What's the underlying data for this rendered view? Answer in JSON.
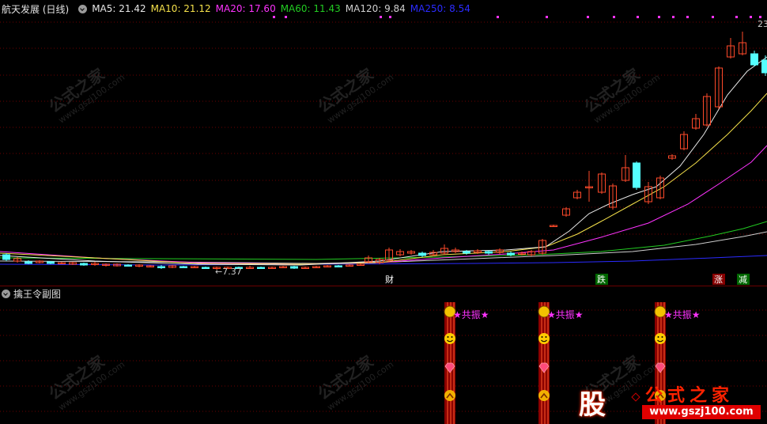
{
  "header": {
    "title": "航天发展 (日线)",
    "indicators": [
      {
        "label": "MA5: 21.42",
        "color": "#e8e8e8"
      },
      {
        "label": "MA10: 21.12",
        "color": "#f5e14a"
      },
      {
        "label": "MA20: 17.60",
        "color": "#ff33ff"
      },
      {
        "label": "MA60: 11.43",
        "color": "#22cc22"
      },
      {
        "label": "MA120: 9.84",
        "color": "#cfcfcf"
      },
      {
        "label": "MA250: 8.54",
        "color": "#2b2bff"
      }
    ]
  },
  "main_chart": {
    "price_high_label": "23",
    "price_low_label": "←7.37",
    "event_labels": [
      {
        "text": "财",
        "color": "#ffffff",
        "bg": "#000000"
      },
      {
        "text": "跌",
        "color": "#ffffff",
        "bg": "#006600"
      },
      {
        "text": "涨",
        "color": "#ffffff",
        "bg": "#880000"
      },
      {
        "text": "减",
        "color": "#ffffff",
        "bg": "#006600"
      }
    ]
  },
  "sub_chart": {
    "title": "擒王令副图",
    "signals": [
      {
        "label": "★共振★"
      },
      {
        "label": "★共振★"
      },
      {
        "label": "★共振★"
      }
    ]
  },
  "watermark": {
    "cn": "公式之家",
    "url": "www.gszj100.com"
  },
  "logo": {
    "gu": "股",
    "cn": "公式之家",
    "url": "www.gszj100.com"
  },
  "colors": {
    "up": "#ff4a2a",
    "down": "#54ffff",
    "grid": "#6b0000",
    "signal": "#ff33ff"
  }
}
